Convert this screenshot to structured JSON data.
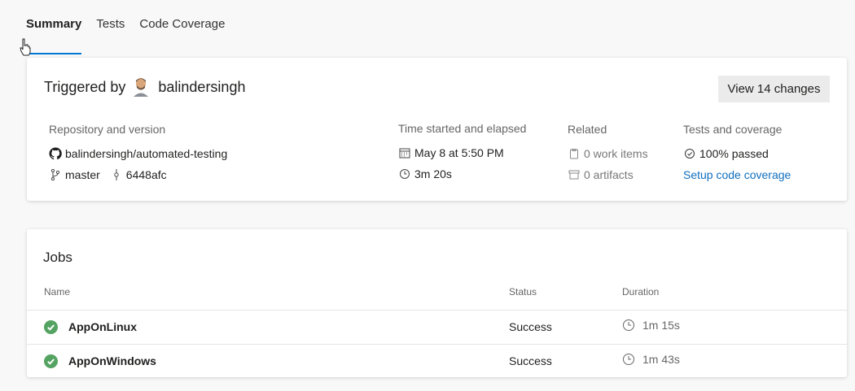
{
  "tabs": [
    {
      "label": "Summary",
      "active": true
    },
    {
      "label": "Tests",
      "active": false
    },
    {
      "label": "Code Coverage",
      "active": false
    }
  ],
  "summary": {
    "triggered_by_label": "Triggered by",
    "user": "balindersingh",
    "view_changes_label": "View 14 changes",
    "repository": {
      "header": "Repository and version",
      "repo": "balindersingh/automated-testing",
      "branch": "master",
      "commit": "6448afc"
    },
    "time": {
      "header": "Time started and elapsed",
      "started": "May 8 at 5:50 PM",
      "elapsed": "3m 20s"
    },
    "related": {
      "header": "Related",
      "work_items": "0 work items",
      "artifacts": "0 artifacts"
    },
    "tests": {
      "header": "Tests and coverage",
      "passed": "100% passed",
      "setup_link": "Setup code coverage"
    }
  },
  "jobs": {
    "title": "Jobs",
    "columns": {
      "name": "Name",
      "status": "Status",
      "duration": "Duration"
    },
    "rows": [
      {
        "name": "AppOnLinux",
        "status": "Success",
        "duration": "1m 15s"
      },
      {
        "name": "AppOnWindows",
        "status": "Success",
        "duration": "1m 43s"
      }
    ]
  },
  "colors": {
    "accent": "#0078d4",
    "success": "#55a362",
    "link": "#106ebe"
  }
}
